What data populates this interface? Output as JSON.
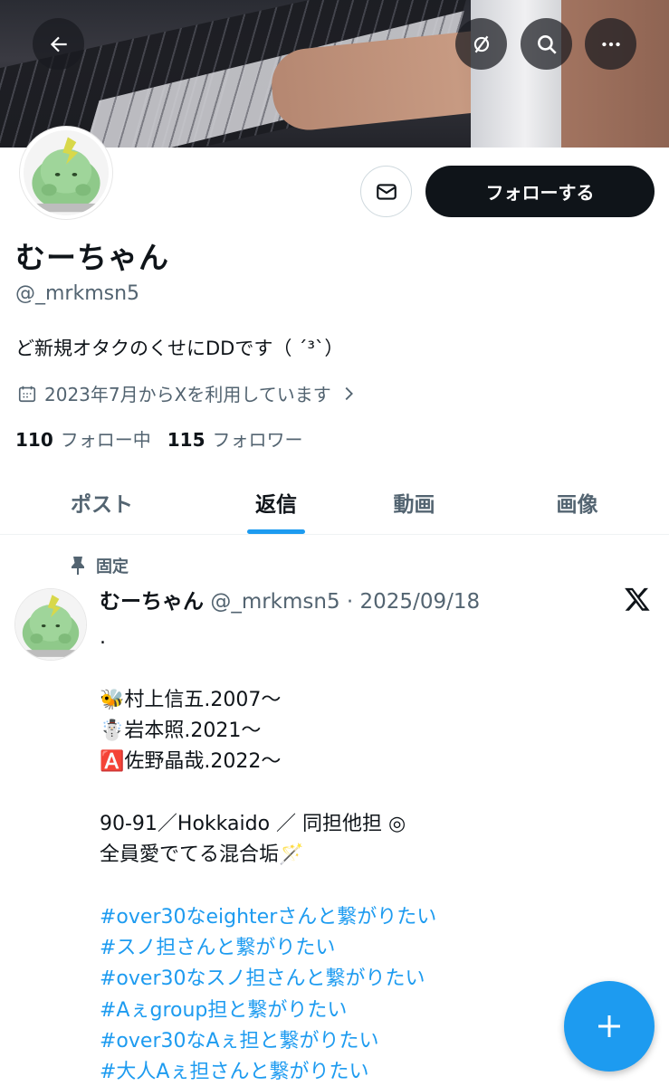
{
  "profile": {
    "name": "むーちゃん",
    "handle": "@_mrkmsn5",
    "bio": "ど新規オタクのくせにDDです（ ´³`）",
    "joined": "2023年7月からXを利用しています",
    "following_count": "110",
    "following_label": "フォロー中",
    "followers_count": "115",
    "followers_label": "フォロワー"
  },
  "actions": {
    "follow_label": "フォローする"
  },
  "tabs": [
    {
      "label": "ポスト"
    },
    {
      "label": "返信"
    },
    {
      "label": "動画"
    },
    {
      "label": "画像"
    }
  ],
  "active_tab": "返信",
  "post": {
    "pinned_label": "固定",
    "author": "むーちゃん",
    "handle": "@_mrkmsn5",
    "date": "2025/09/18",
    "lines": [
      ".",
      "",
      "🐝村上信五.2007～",
      "☃️岩本照.2021～",
      "🅰️佐野晶哉.2022～",
      "",
      "90-91／Hokkaido ／ 同担他担 ◎",
      "全員愛でてる混合垢🪄",
      ""
    ],
    "hashtags": [
      "#over30なeighterさんと繋がりたい",
      " #スノ担さんと繋がりたい",
      "#over30なスノ担さんと繋がりたい",
      "#Aぇgroup担と繋がりたい",
      "#over30なAぇ担と繋がりたい",
      "#大人Aぇ担さんと繋がりたい"
    ]
  },
  "colors": {
    "accent": "#1d9bf0",
    "text": "#0f1419",
    "muted": "#536471",
    "follow_bg": "#0f1419"
  }
}
